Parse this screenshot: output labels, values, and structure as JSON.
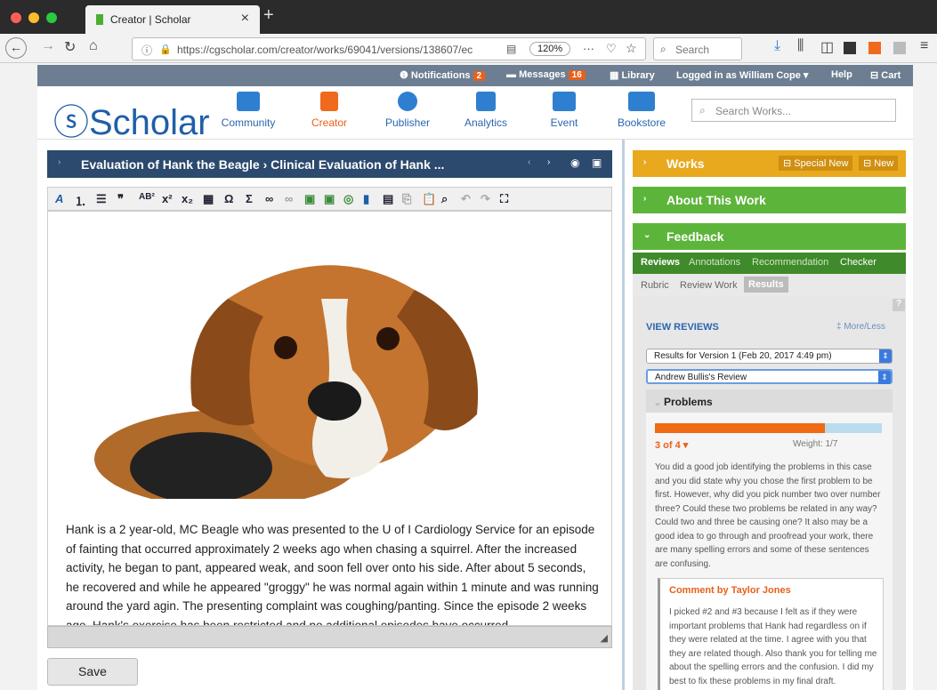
{
  "browser": {
    "tab_title": "Creator | Scholar",
    "url": "https://cgscholar.com/creator/works/69041/versions/138607/ec",
    "zoom": "120%",
    "search_placeholder": "Search"
  },
  "topbar": {
    "notifications_label": "Notifications",
    "notifications_count": "2",
    "messages_label": "Messages",
    "messages_count": "16",
    "library_label": "Library",
    "logged_in": "Logged in as William Cope",
    "help_label": "Help",
    "cart_label": "Cart"
  },
  "header": {
    "logo": "Scholar",
    "nav": [
      "Community",
      "Creator",
      "Publisher",
      "Analytics",
      "Event",
      "Bookstore"
    ],
    "search_placeholder": "Search Works..."
  },
  "editor": {
    "title": "Evaluation of Hank the Beagle › Clinical Evaluation of Hank ...",
    "body": "Hank is a 2 year-old, MC Beagle who was presented to the U of I Cardiology Service for an episode of fainting that occurred approximately 2 weeks ago when chasing a squirrel. After the increased activity, he began to pant, appeared weak, and soon fell over onto his side. After about 5 seconds, he recovered and while he appeared \"groggy\" he was normal again within 1 minute and was running around the yard agin. The presenting complaint was coughing/panting. Since the episode 2 weeks ago, Hank's exercise has been restricted and no additional episodes have occurred.",
    "save_label": "Save"
  },
  "sidebar": {
    "works_label": "Works",
    "special_new_label": "Special New",
    "new_label": "New",
    "about_label": "About This Work",
    "feedback_label": "Feedback",
    "subtabs": [
      "Reviews",
      "Annotations",
      "Recommendation",
      "Checker"
    ],
    "rubric_tabs": [
      "Rubric",
      "Review Work",
      "Results"
    ],
    "view_reviews": "VIEW REVIEWS",
    "more_less": "More/Less",
    "version_select": "Results for Version 1 (Feb 20, 2017 4:49 pm)",
    "review_select": "Andrew Bullis's Review",
    "section_title": "Problems",
    "score": "3 of 4",
    "score_fraction": 0.75,
    "weight": "Weight: 1/7",
    "feedback_text": "You did a good job identifying the problems in this case and you did state why you chose the first problem to be first. However, why did you pick number two over number three? Could these two problems be related in any way? Could two and three be causing one? It also may be a good idea to go through and proofread your work, there are many spelling errors and some of these sentences are confusing.",
    "comment_by": "Comment by Taylor Jones",
    "comment_text": "I picked #2 and #3 because I felt as if they were important problems that Hank had regardless on if they were related at the time. I agree with you that they are related though. Also thank you for telling me about the spelling errors and the confusion. I did my best to fix these problems in my final draft."
  }
}
